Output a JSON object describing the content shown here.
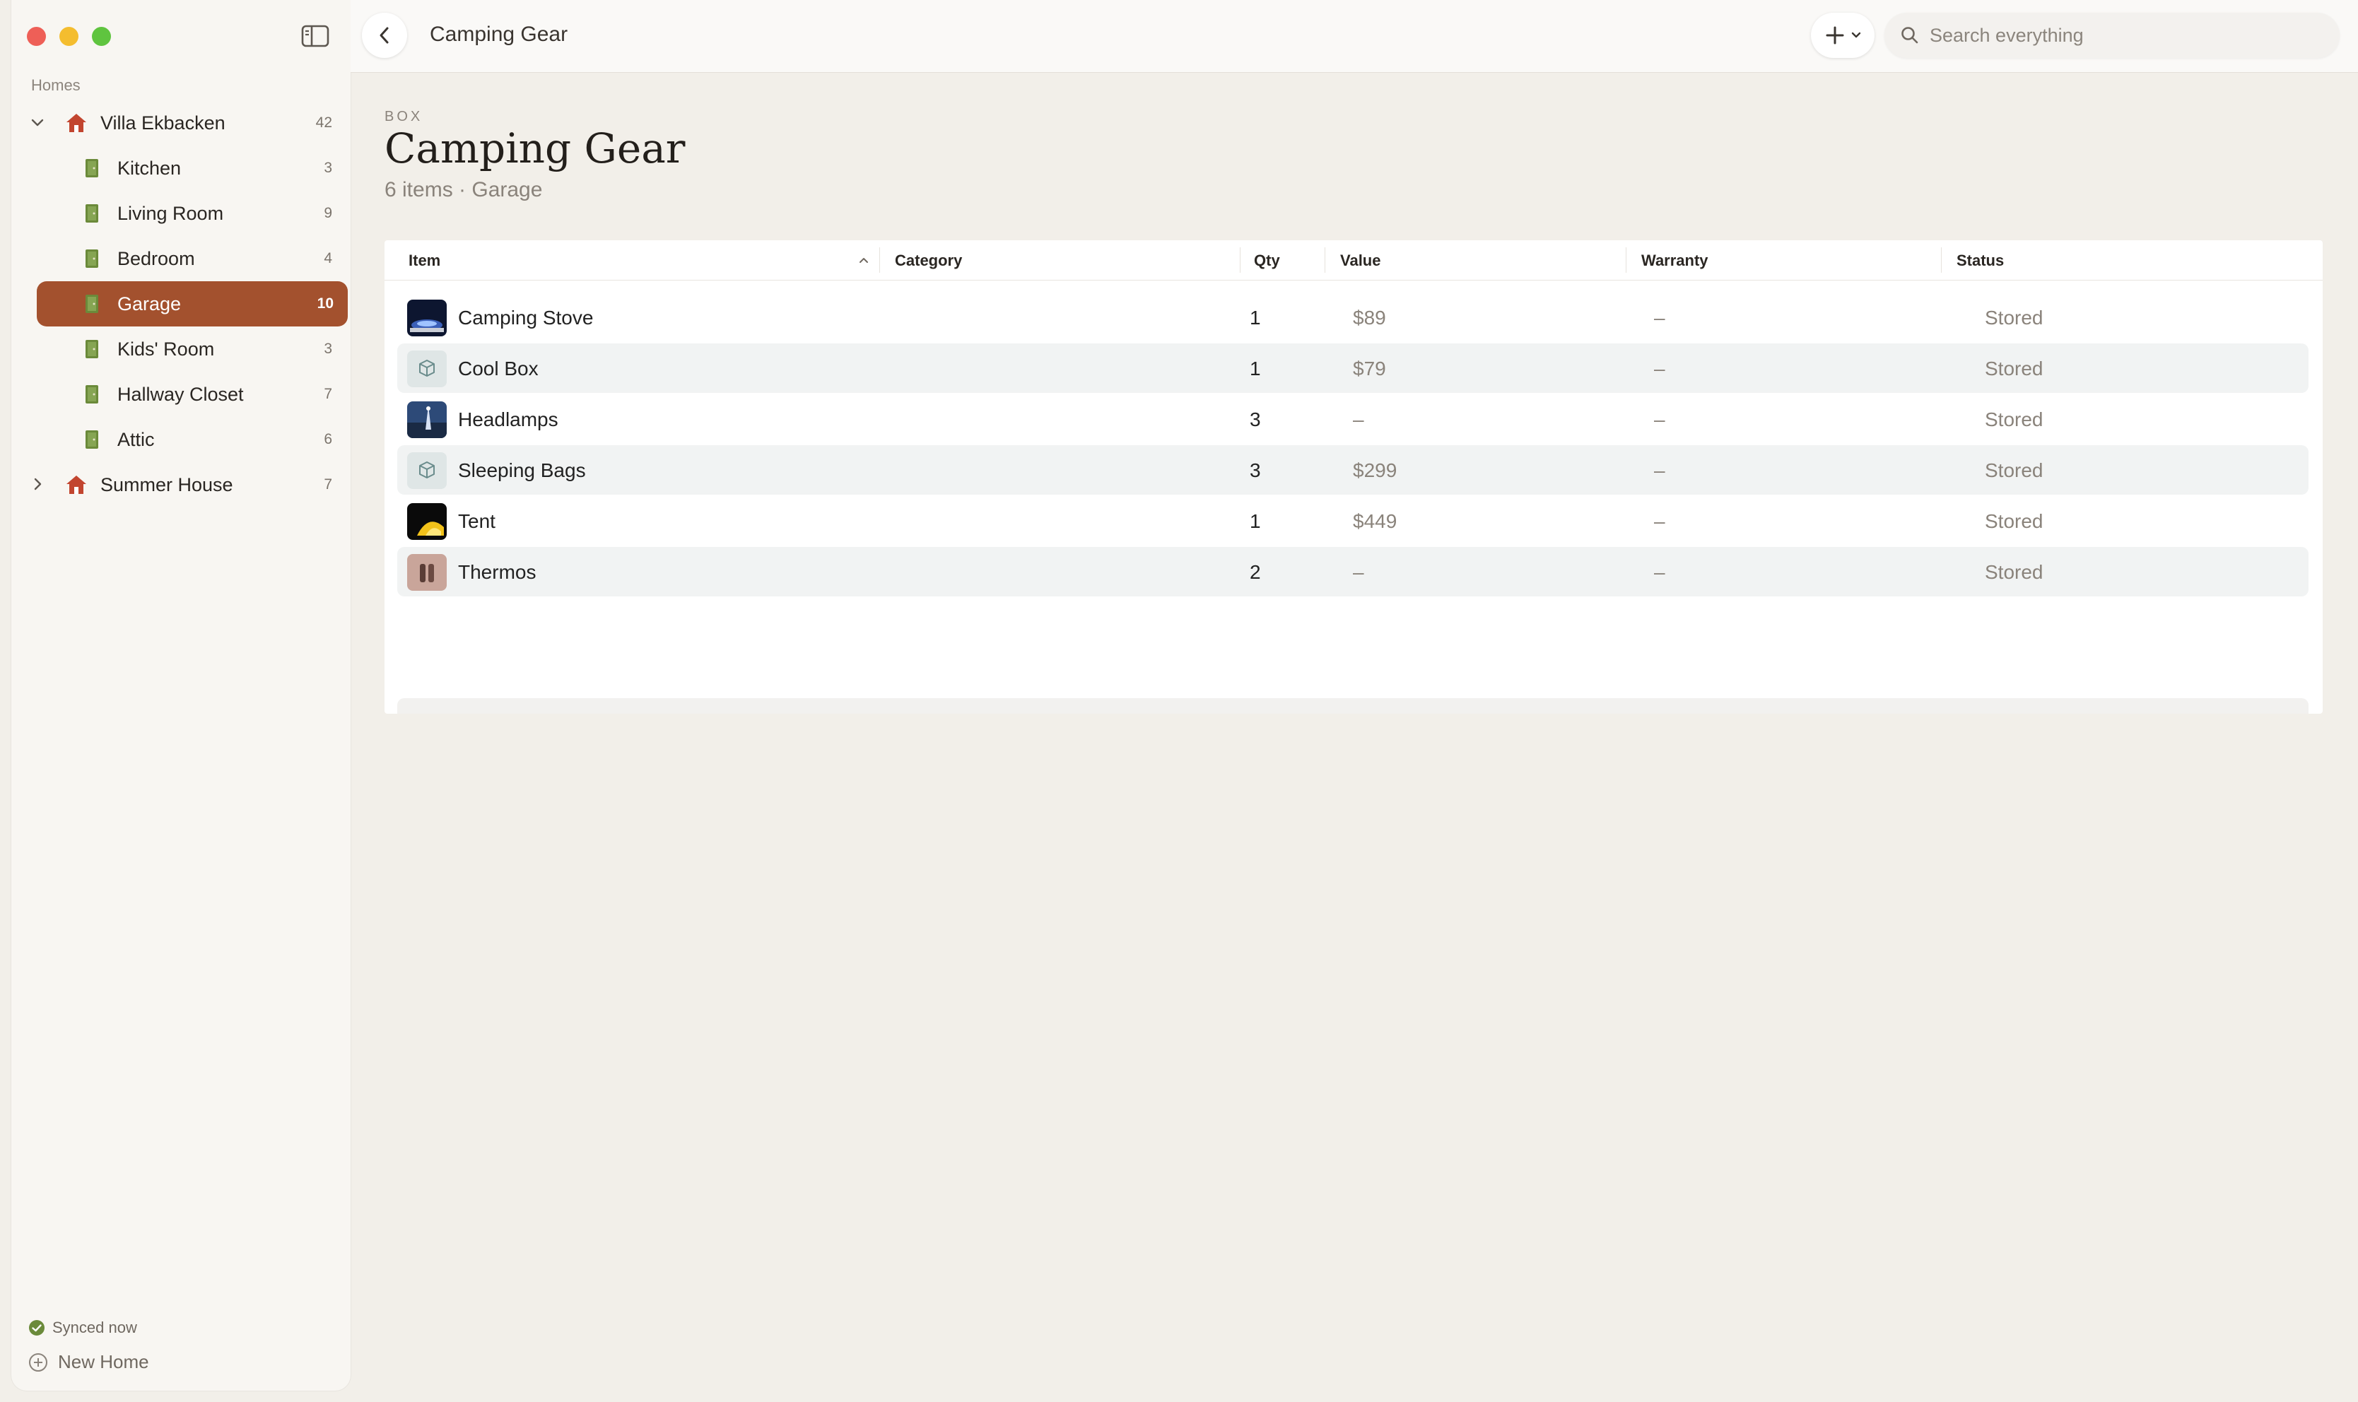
{
  "sidebar": {
    "homes_label": "Homes",
    "tree": [
      {
        "type": "home",
        "label": "Villa Ekbacken",
        "count": "42",
        "expanded": true
      },
      {
        "type": "room",
        "label": "Kitchen",
        "count": "3"
      },
      {
        "type": "room",
        "label": "Living Room",
        "count": "9"
      },
      {
        "type": "room",
        "label": "Bedroom",
        "count": "4"
      },
      {
        "type": "room",
        "label": "Garage",
        "count": "10",
        "active": true
      },
      {
        "type": "room",
        "label": "Kids' Room",
        "count": "3"
      },
      {
        "type": "room",
        "label": "Hallway Closet",
        "count": "7"
      },
      {
        "type": "room",
        "label": "Attic",
        "count": "6"
      },
      {
        "type": "home",
        "label": "Summer House",
        "count": "7",
        "expanded": false
      }
    ],
    "sync_status": "Synced now",
    "new_home": "New Home"
  },
  "topbar": {
    "title": "Camping Gear",
    "search_placeholder": "Search everything"
  },
  "page": {
    "kicker": "BOX",
    "title": "Camping Gear",
    "subtitle": "6 items · Garage"
  },
  "table": {
    "columns": [
      "Item",
      "Category",
      "Qty",
      "Value",
      "Warranty",
      "Status"
    ],
    "rows": [
      {
        "name": "Camping Stove",
        "category": "",
        "qty": "1",
        "value": "$89",
        "warranty": "–",
        "status": "Stored",
        "thumb": "photo-stove"
      },
      {
        "name": "Cool Box",
        "category": "",
        "qty": "1",
        "value": "$79",
        "warranty": "–",
        "status": "Stored",
        "thumb": "box-icon"
      },
      {
        "name": "Headlamps",
        "category": "",
        "qty": "3",
        "value": "–",
        "warranty": "–",
        "status": "Stored",
        "thumb": "photo-headlamps"
      },
      {
        "name": "Sleeping Bags",
        "category": "",
        "qty": "3",
        "value": "$299",
        "warranty": "–",
        "status": "Stored",
        "thumb": "box-icon"
      },
      {
        "name": "Tent",
        "category": "",
        "qty": "1",
        "value": "$449",
        "warranty": "–",
        "status": "Stored",
        "thumb": "photo-tent"
      },
      {
        "name": "Thermos",
        "category": "",
        "qty": "2",
        "value": "–",
        "warranty": "–",
        "status": "Stored",
        "thumb": "photo-thermos"
      }
    ]
  },
  "colors": {
    "accent": "#a3512e",
    "home_icon": "#c2452f",
    "room_icon": "#6b8a3a",
    "sync_ok": "#6b8a3a"
  }
}
